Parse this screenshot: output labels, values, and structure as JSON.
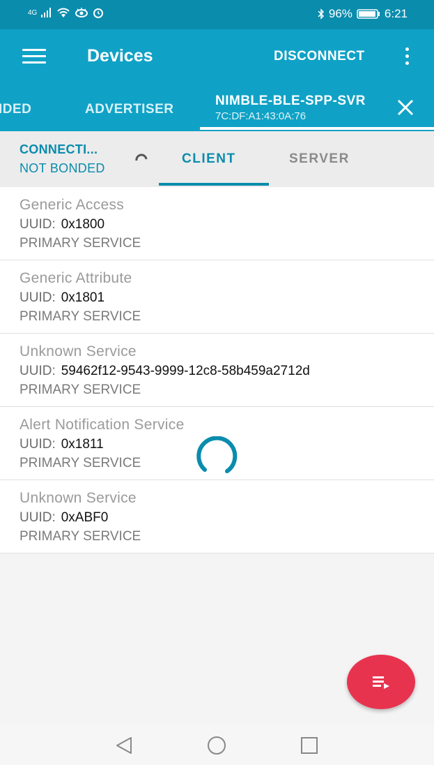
{
  "status_bar": {
    "network": "4G",
    "battery": "96%",
    "time": "6:21"
  },
  "toolbar": {
    "title": "Devices",
    "disconnect_label": "DISCONNECT"
  },
  "device_tabs": [
    {
      "label": "IDED"
    },
    {
      "label": "ADVERTISER"
    },
    {
      "label": "NIMBLE-BLE-SPP-SVR",
      "mac": "7C:DF:A1:43:0A:76",
      "active": true
    }
  ],
  "connection": {
    "state": "CONNECTI...",
    "bond": "NOT BONDED"
  },
  "sub_tabs": [
    {
      "label": "CLIENT",
      "active": true
    },
    {
      "label": "SERVER",
      "active": false
    }
  ],
  "services": [
    {
      "name": "Generic Access",
      "uuid_label": "UUID:",
      "uuid": "0x1800",
      "type": "PRIMARY SERVICE"
    },
    {
      "name": "Generic Attribute",
      "uuid_label": "UUID:",
      "uuid": "0x1801",
      "type": "PRIMARY SERVICE"
    },
    {
      "name": "Unknown Service",
      "uuid_label": "UUID:",
      "uuid": "59462f12-9543-9999-12c8-58b459a2712d",
      "type": "PRIMARY SERVICE"
    },
    {
      "name": "Alert Notification Service",
      "uuid_label": "UUID:",
      "uuid": "0x1811",
      "type": "PRIMARY SERVICE"
    },
    {
      "name": "Unknown Service",
      "uuid_label": "UUID:",
      "uuid": "0xABF0",
      "type": "PRIMARY SERVICE"
    }
  ],
  "icons": {
    "menu": "hamburger-icon",
    "overflow": "more-vert-icon",
    "close": "close-icon",
    "refresh": "refresh-icon",
    "fab": "log-list-icon",
    "nav_back": "back-triangle-icon",
    "nav_home": "home-circle-icon",
    "nav_recents": "recents-square-icon"
  },
  "colors": {
    "status_bar": "#0a8cad",
    "toolbar": "#10a2c6",
    "accent": "#0a8cad",
    "fab": "#e8334f"
  }
}
